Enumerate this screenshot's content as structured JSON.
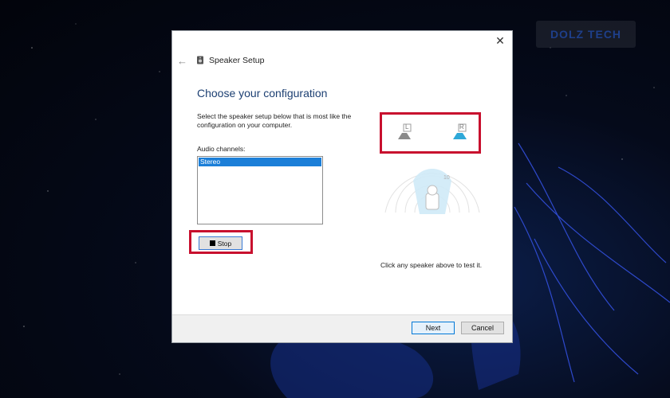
{
  "watermark": {
    "text": "DOLZ TECH"
  },
  "dialog": {
    "title": "Speaker Setup",
    "heading": "Choose your configuration",
    "description": "Select the speaker setup below that is most like the configuration on your computer.",
    "channels_label": "Audio channels:",
    "channels_selected": "Stereo",
    "stop_label": "Stop",
    "hint": "Click any speaker above to test it.",
    "speaker_left": "L",
    "speaker_right": "R",
    "next_label": "Next",
    "cancel_label": "Cancel"
  },
  "colors": {
    "heading": "#1c3f72",
    "selection": "#1c7fd8",
    "highlight_box": "#c8102e"
  },
  "icons": {
    "close": "close-icon",
    "back": "back-arrow-icon",
    "title": "speaker-icon",
    "stop": "stop-square-icon"
  }
}
